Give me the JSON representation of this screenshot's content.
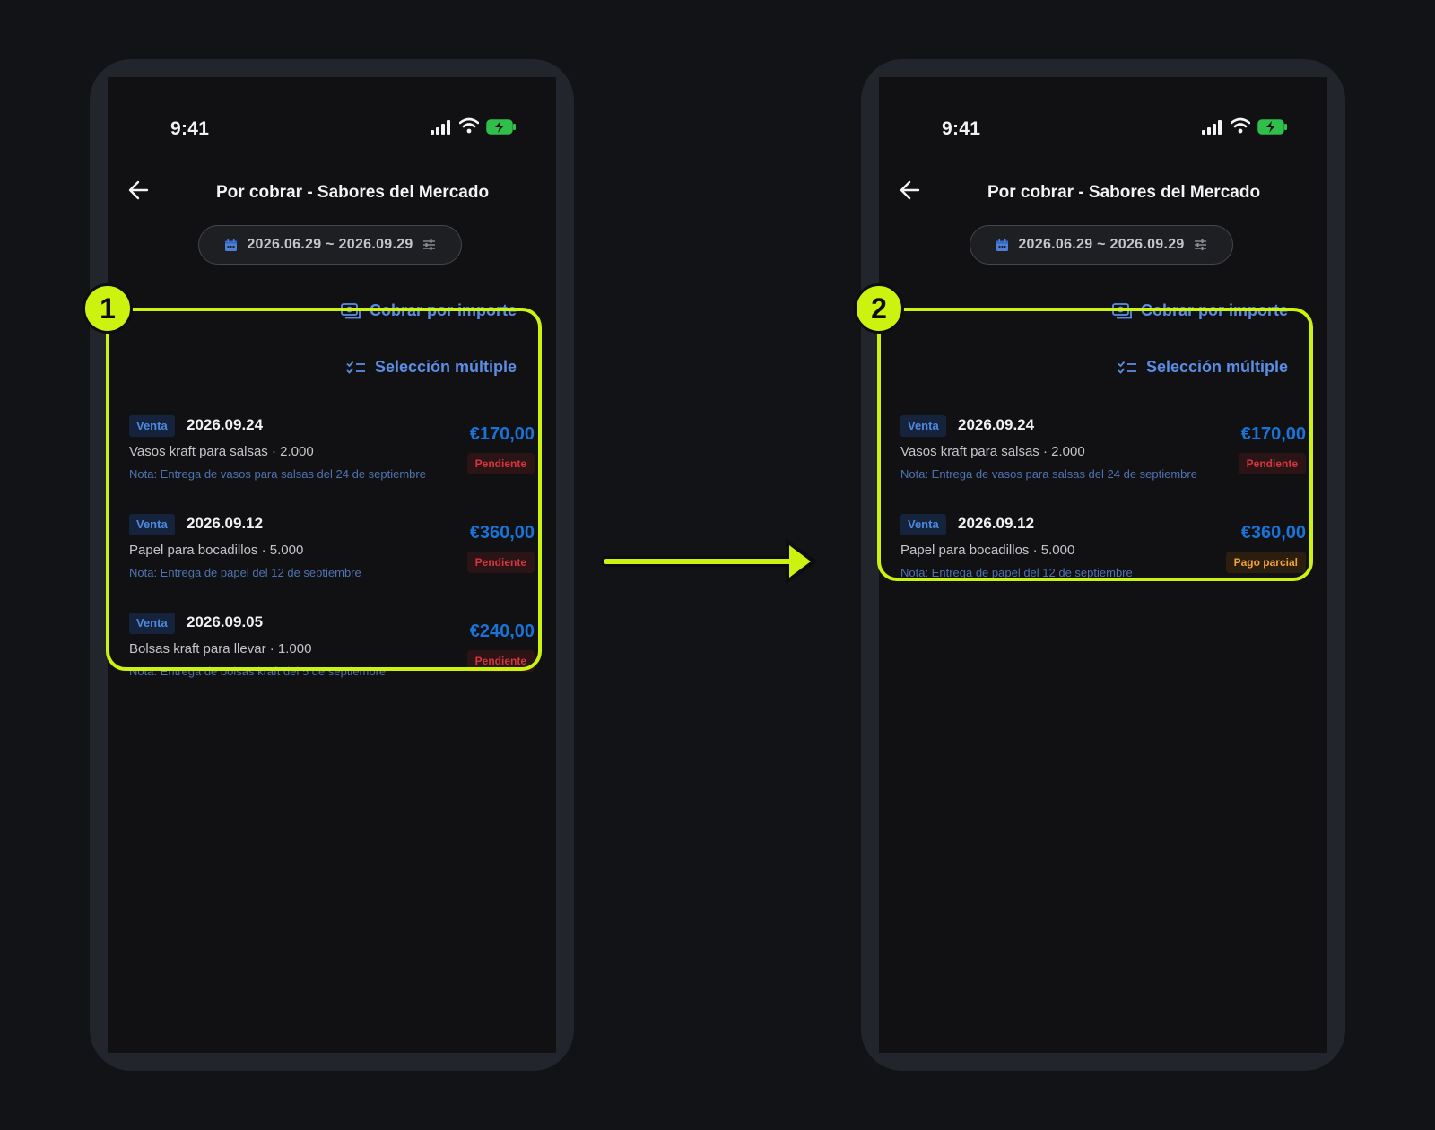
{
  "colors": {
    "accent": "#5b8de4",
    "amount": "#1a73d8",
    "highlight": "#ccf20f",
    "pending": "#d3363c",
    "partial": "#f0a23a"
  },
  "steps": [
    "1",
    "2"
  ],
  "left": {
    "status": {
      "time": "9:41"
    },
    "header": {
      "title": "Por cobrar - Sabores del Mercado"
    },
    "filter": {
      "range": "2026.06.29 ~ 2026.09.29"
    },
    "actions": {
      "collect": "Cobrar por importe",
      "multi": "Selección múltiple"
    },
    "items": [
      {
        "tag": "Venta",
        "date": "2026.09.24",
        "desc": "Vasos kraft para salsas · 2.000",
        "note": "Nota: Entrega de vasos para salsas del 24 de septiembre",
        "amount": "€170,00",
        "status": "Pendiente"
      },
      {
        "tag": "Venta",
        "date": "2026.09.12",
        "desc": "Papel para bocadillos · 5.000",
        "note": "Nota: Entrega de papel del 12 de septiembre",
        "amount": "€360,00",
        "status": "Pendiente"
      },
      {
        "tag": "Venta",
        "date": "2026.09.05",
        "desc": "Bolsas kraft para llevar · 1.000",
        "note": "Nota: Entrega de bolsas kraft del 5 de septiembre",
        "amount": "€240,00",
        "status": "Pendiente"
      }
    ]
  },
  "right": {
    "status": {
      "time": "9:41"
    },
    "header": {
      "title": "Por cobrar - Sabores del Mercado"
    },
    "filter": {
      "range": "2026.06.29 ~ 2026.09.29"
    },
    "actions": {
      "collect": "Cobrar por importe",
      "multi": "Selección múltiple"
    },
    "items": [
      {
        "tag": "Venta",
        "date": "2026.09.24",
        "desc": "Vasos kraft para salsas · 2.000",
        "note": "Nota: Entrega de vasos para salsas del 24 de septiembre",
        "amount": "€170,00",
        "status": "Pendiente"
      },
      {
        "tag": "Venta",
        "date": "2026.09.12",
        "desc": "Papel para bocadillos · 5.000",
        "note": "Nota: Entrega de papel del 12 de septiembre",
        "amount": "€360,00",
        "status": "Pago parcial"
      }
    ]
  }
}
